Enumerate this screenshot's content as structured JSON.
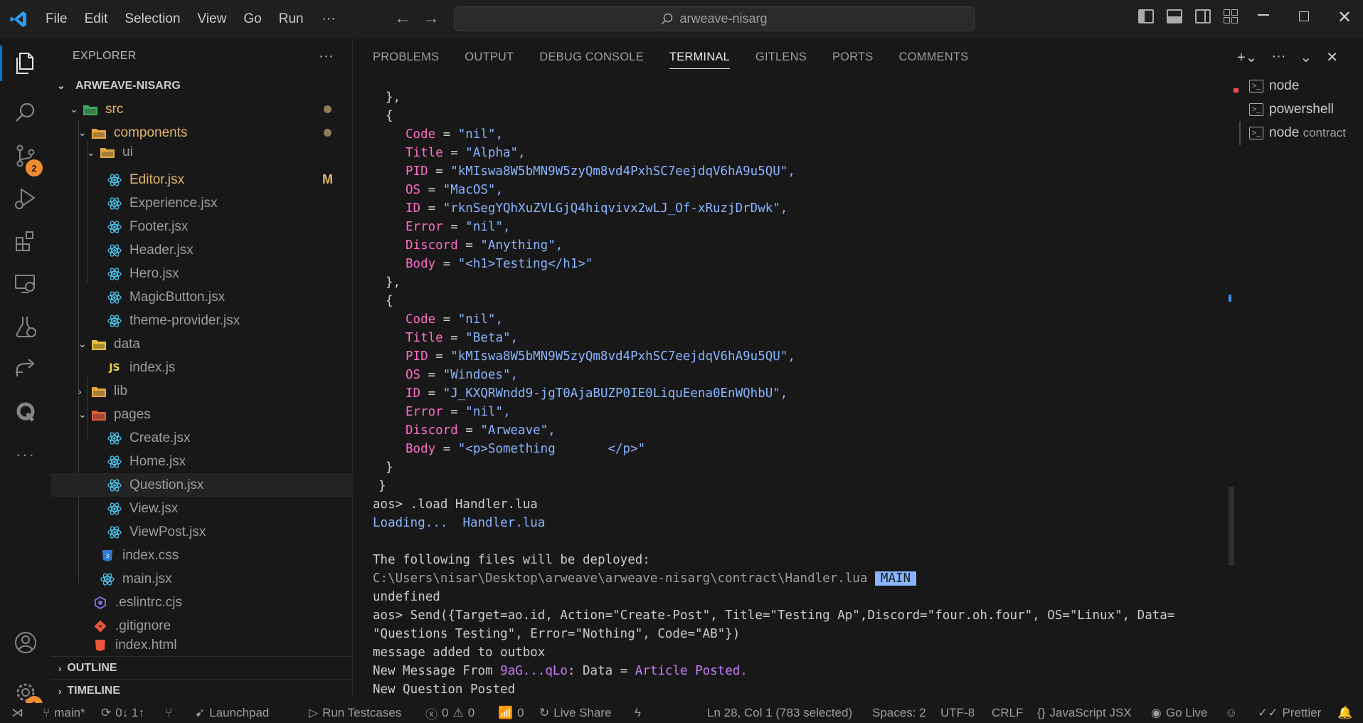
{
  "menu": {
    "items": [
      "File",
      "Edit",
      "Selection",
      "View",
      "Go",
      "Run"
    ],
    "more": "···"
  },
  "search": {
    "text": "arweave-nisarg"
  },
  "activity": {
    "source_control_badge": "2",
    "settings_badge": "1"
  },
  "explorer": {
    "title": "EXPLORER",
    "more": "···",
    "root": "ARWEAVE-NISARG",
    "tree": [
      {
        "label": "src",
        "kind": "folder"
      },
      {
        "label": "components",
        "kind": "folder"
      },
      {
        "label": "ui",
        "kind": "folder"
      },
      {
        "label": "Editor.jsx",
        "kind": "react",
        "flag": "M"
      },
      {
        "label": "Experience.jsx",
        "kind": "react"
      },
      {
        "label": "Footer.jsx",
        "kind": "react"
      },
      {
        "label": "Header.jsx",
        "kind": "react"
      },
      {
        "label": "Hero.jsx",
        "kind": "react"
      },
      {
        "label": "MagicButton.jsx",
        "kind": "react"
      },
      {
        "label": "theme-provider.jsx",
        "kind": "react"
      },
      {
        "label": "data",
        "kind": "folder"
      },
      {
        "label": "index.js",
        "kind": "js"
      },
      {
        "label": "lib",
        "kind": "folder"
      },
      {
        "label": "pages",
        "kind": "folder"
      },
      {
        "label": "Create.jsx",
        "kind": "react"
      },
      {
        "label": "Home.jsx",
        "kind": "react"
      },
      {
        "label": "Question.jsx",
        "kind": "react"
      },
      {
        "label": "View.jsx",
        "kind": "react"
      },
      {
        "label": "ViewPost.jsx",
        "kind": "react"
      },
      {
        "label": "index.css",
        "kind": "css"
      },
      {
        "label": "main.jsx",
        "kind": "react"
      },
      {
        "label": ".eslintrc.cjs",
        "kind": "eslint"
      },
      {
        "label": ".gitignore",
        "kind": "git"
      },
      {
        "label": "index.html",
        "kind": "html"
      }
    ],
    "outline": "OUTLINE",
    "timeline": "TIMELINE"
  },
  "panel": {
    "tabs": [
      "PROBLEMS",
      "OUTPUT",
      "DEBUG CONSOLE",
      "TERMINAL",
      "GITLENS",
      "PORTS",
      "COMMENTS"
    ],
    "active_tab": "TERMINAL"
  },
  "terminal": {
    "close_obj": "},",
    "open_brace": "{",
    "close_brace": "}",
    "records": [
      {
        "Code": "\"nil\",",
        "Title": "\"Alpha\",",
        "PID": "\"kMIswa8W5bMN9W5zyQm8vd4PxhSC7eejdqV6hA9u5QU\",",
        "OS": "\"MacOS\",",
        "ID": "\"rknSegYQhXuZVLGjQ4hiqvivx2wLJ_Of-xRuzjDrDwk\",",
        "Error": "\"nil\",",
        "Discord": "\"Anything\",",
        "Body": "\"<h1>Testing</h1>\""
      },
      {
        "Code": "\"nil\",",
        "Title": "\"Beta\",",
        "PID": "\"kMIswa8W5bMN9W5zyQm8vd4PxhSC7eejdqV6hA9u5QU\",",
        "OS": "\"Windoes\",",
        "ID": "\"J_KXQRWndd9-jgT0AjaBUZP0IE0LiquEena0EnWQhbU\",",
        "Error": "\"nil\",",
        "Discord": "\"Arweave\",",
        "Body": "\"<p>Something       </p>\""
      }
    ],
    "load_cmd": "aos> .load Handler.lua",
    "loading_label": "Loading...",
    "loading_file": "Handler.lua",
    "deploy_msg": "The following files will be deployed:",
    "deploy_path": "C:\\Users\\nisar\\Desktop\\arweave\\arweave-nisarg\\contract\\Handler.lua",
    "deploy_tag": "MAIN",
    "undefined": "undefined",
    "send_cmd_1": "aos> Send({Target=ao.id, Action=\"Create-Post\", Title=\"Testing Ap\",Discord=\"four.oh.four\", OS=\"Linux\", Data=",
    "send_cmd_2": "\"Questions Testing\", Error=\"Nothing\", Code=\"AB\"})",
    "outbox": "message added to outbox",
    "new_msg_prefix": "New Message From ",
    "new_msg_from": "9aG...qLo",
    "new_msg_mid": ": Data = ",
    "new_msg_data": "Article Posted.",
    "new_question": "New Question Posted"
  },
  "terminal_list": [
    {
      "label": "node",
      "sub": ""
    },
    {
      "label": "powershell",
      "sub": ""
    },
    {
      "label": "node",
      "sub": "contract"
    }
  ],
  "status": {
    "branch": "main*",
    "sync": "0↓ 1↑",
    "launchpad": "Launchpad",
    "run_testcases": "Run Testcases",
    "errors": "0",
    "warnings": "0",
    "ports": "0",
    "live_share": "Live Share",
    "position": "Ln 28, Col 1 (783 selected)",
    "spaces": "Spaces: 2",
    "encoding": "UTF-8",
    "eol": "CRLF",
    "language": "JavaScript JSX",
    "go_live": "Go Live",
    "prettier": "Prettier"
  }
}
